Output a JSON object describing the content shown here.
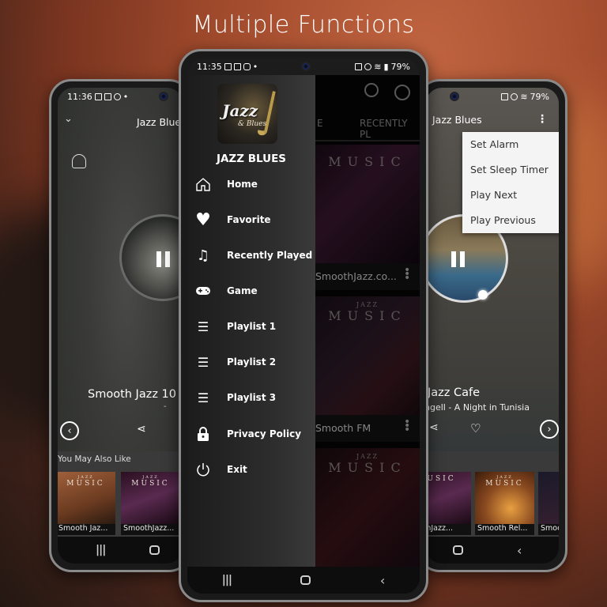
{
  "headline": "Multiple Functions",
  "colors": {
    "background_accent": "#a04a2c",
    "drawer_bg": "#2e2e2e",
    "popup_bg": "#f4f4f4"
  },
  "left_phone": {
    "status": {
      "time": "11:36",
      "icons": [
        "notification-icon",
        "gallery-icon",
        "whatsapp-icon",
        "dot"
      ]
    },
    "collapse_icon": "chevron-down-icon",
    "title": "Jazz Blue",
    "alarm_icon": "bell-icon",
    "now_playing": {
      "title": "Smooth Jazz 10",
      "subtitle": "-",
      "state": "playing"
    },
    "controls": {
      "prev": "‹",
      "share": "share-icon",
      "favorite": "heart-icon"
    },
    "suggest_header": "You May Also Like",
    "suggestions": [
      {
        "caption": "Smooth Jaz...",
        "art_title": "MUSIC",
        "art_sub": "JAZZ"
      },
      {
        "caption": "SmoothJazz...",
        "art_title": "MUSIC",
        "art_sub": "JAZZ"
      }
    ],
    "nav": {
      "recents": "|||",
      "home": "○"
    }
  },
  "center_phone": {
    "status": {
      "time": "11:35",
      "battery": "79%"
    },
    "toolbar": {
      "search_icon": "search-icon",
      "power_icon": "power-icon"
    },
    "tabs": [
      "E",
      "RECENTLY PL"
    ],
    "drawer": {
      "app_name": "JAZZ BLUES",
      "logo_text": "Jazz",
      "logo_sub": "& Blues",
      "items": [
        {
          "label": "Home",
          "icon": "home-icon"
        },
        {
          "label": "Favorite",
          "icon": "heart-icon"
        },
        {
          "label": "Recently Played",
          "icon": "music-note-icon"
        },
        {
          "label": "Game",
          "icon": "gamepad-icon"
        },
        {
          "label": "Playlist 1",
          "icon": "playlist-icon"
        },
        {
          "label": "Playlist 2",
          "icon": "playlist-icon"
        },
        {
          "label": "Playlist 3",
          "icon": "playlist-icon"
        },
        {
          "label": "Privacy Policy",
          "icon": "lock-icon"
        },
        {
          "label": "Exit",
          "icon": "power-icon"
        }
      ]
    },
    "stations": [
      {
        "caption": "SmoothJazz.co...",
        "art_title": "MUSIC",
        "art_sub": "JAZZ"
      },
      {
        "caption": "Smooth FM",
        "art_title": "MUSIC",
        "art_sub": "JAZZ"
      },
      {
        "caption": "",
        "art_title": "MUSIC",
        "art_sub": "JAZZ"
      }
    ],
    "nav": {
      "recents": "|||",
      "home": "○",
      "back": "‹"
    }
  },
  "right_phone": {
    "status": {
      "battery": "79%"
    },
    "title": "Jazz Blues",
    "overflow_icon": "more-vertical-icon",
    "popup_menu": [
      "Set Alarm",
      "Set Sleep Timer",
      "Play Next",
      "Play Previous"
    ],
    "now_playing": {
      "title": "Jazz Cafe",
      "subtitle": "ngell - A Night in Tunisia",
      "state": "playing"
    },
    "controls": {
      "share": "share-icon",
      "favorite": "heart-icon",
      "next": "›"
    },
    "suggestions": [
      {
        "caption": "oothJazz...",
        "art_title": "USIC"
      },
      {
        "caption": "Smooth Rel...",
        "art_title": "MUSIC",
        "art_sub": "JAZZ"
      },
      {
        "caption": "Smoo",
        "art_title": "MU"
      }
    ],
    "nav": {
      "home": "○",
      "back": "‹"
    }
  }
}
